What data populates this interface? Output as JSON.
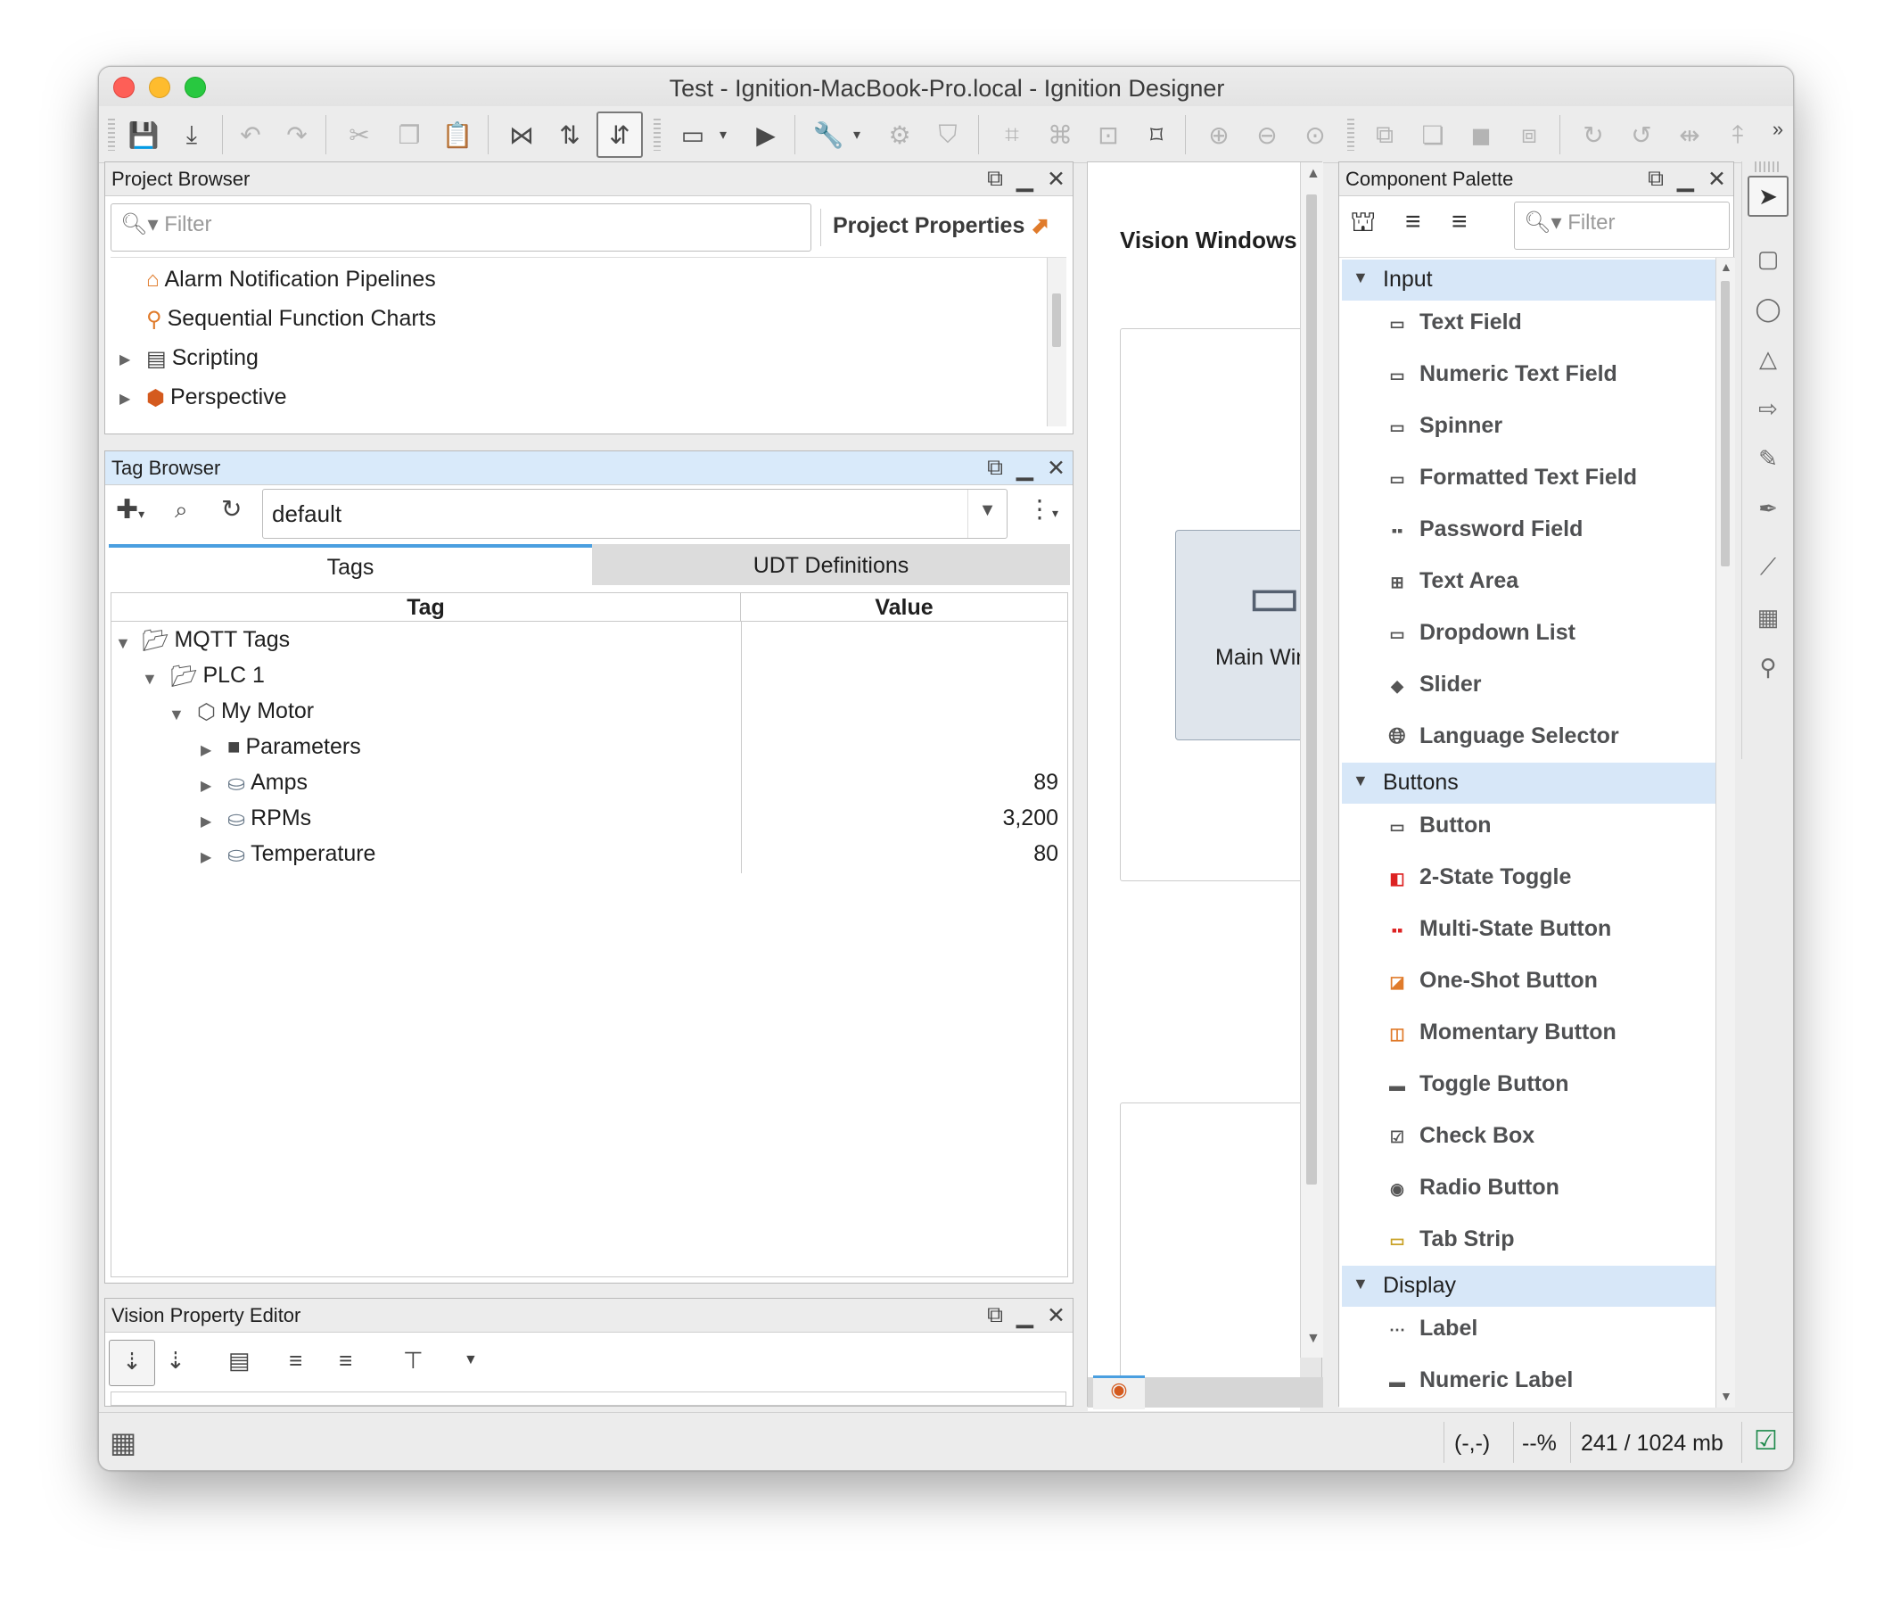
{
  "window": {
    "title": "Test - Ignition-MacBook-Pro.local - Ignition Designer"
  },
  "toolbar": {
    "icons": [
      "save-icon",
      "save-all-icon",
      "undo-icon",
      "redo-icon",
      "cut-icon",
      "copy-icon",
      "paste-icon",
      "tag-icon",
      "refresh-icon",
      "comm-mode-icon",
      "window-icon",
      "play-icon",
      "wrench-icon",
      "script-icon",
      "shield-icon",
      "align-icon",
      "group-icon",
      "ungroup-icon",
      "crop-icon",
      "zoom-in-icon",
      "zoom-out-icon",
      "zoom-fit-icon",
      "layer-front-icon",
      "layer-back-icon",
      "layer-forward-icon",
      "layer-backward-icon",
      "rotate-cw-icon",
      "rotate-ccw-icon",
      "flip-h-icon",
      "flip-v-icon"
    ],
    "overflow": "»"
  },
  "project_browser": {
    "title": "Project Browser",
    "filter_placeholder": "Filter",
    "project_properties": "Project Properties",
    "items": [
      {
        "label": "Alarm Notification Pipelines",
        "icon": "pipeline-icon",
        "expandable": false
      },
      {
        "label": "Sequential Function Charts",
        "icon": "sfc-icon",
        "expandable": false
      },
      {
        "label": "Scripting",
        "icon": "scripting-icon",
        "expandable": true
      },
      {
        "label": "Perspective",
        "icon": "perspective-icon",
        "expandable": true
      }
    ]
  },
  "tag_browser": {
    "title": "Tag Browser",
    "provider": "default",
    "tabs": [
      {
        "label": "Tags",
        "active": true
      },
      {
        "label": "UDT Definitions",
        "active": false
      }
    ],
    "columns": [
      "Tag",
      "Value"
    ],
    "rows": [
      {
        "label": "MQTT Tags",
        "value": "",
        "icon": "folder-open-icon"
      },
      {
        "label": "PLC 1",
        "value": "",
        "icon": "folder-open-icon"
      },
      {
        "label": "My Motor",
        "value": "",
        "icon": "udt-instance-icon"
      },
      {
        "label": "Parameters",
        "value": "",
        "icon": "parameters-icon"
      },
      {
        "label": "Amps",
        "value": "89",
        "icon": "mqtt-tag-icon"
      },
      {
        "label": "RPMs",
        "value": "3,200",
        "icon": "mqtt-tag-icon"
      },
      {
        "label": "Temperature",
        "value": "80",
        "icon": "mqtt-tag-icon"
      }
    ]
  },
  "vision_property_editor": {
    "title": "Vision Property Editor"
  },
  "workspace": {
    "heading": "Vision Windows",
    "card_label": "Main Window"
  },
  "component_palette": {
    "title": "Component Palette",
    "filter_placeholder": "Filter",
    "categories": [
      {
        "name": "Input",
        "items": [
          "Text Field",
          "Numeric Text Field",
          "Spinner",
          "Formatted Text Field",
          "Password Field",
          "Text Area",
          "Dropdown List",
          "Slider",
          "Language Selector"
        ]
      },
      {
        "name": "Buttons",
        "items": [
          "Button",
          "2-State Toggle",
          "Multi-State Button",
          "One-Shot Button",
          "Momentary Button",
          "Toggle Button",
          "Check Box",
          "Radio Button",
          "Tab Strip"
        ]
      },
      {
        "name": "Display",
        "items": [
          "Label",
          "Numeric Label"
        ]
      }
    ]
  },
  "status_bar": {
    "coords": "(-,-)",
    "zoom": "--%",
    "memory": "241 / 1024 mb"
  }
}
